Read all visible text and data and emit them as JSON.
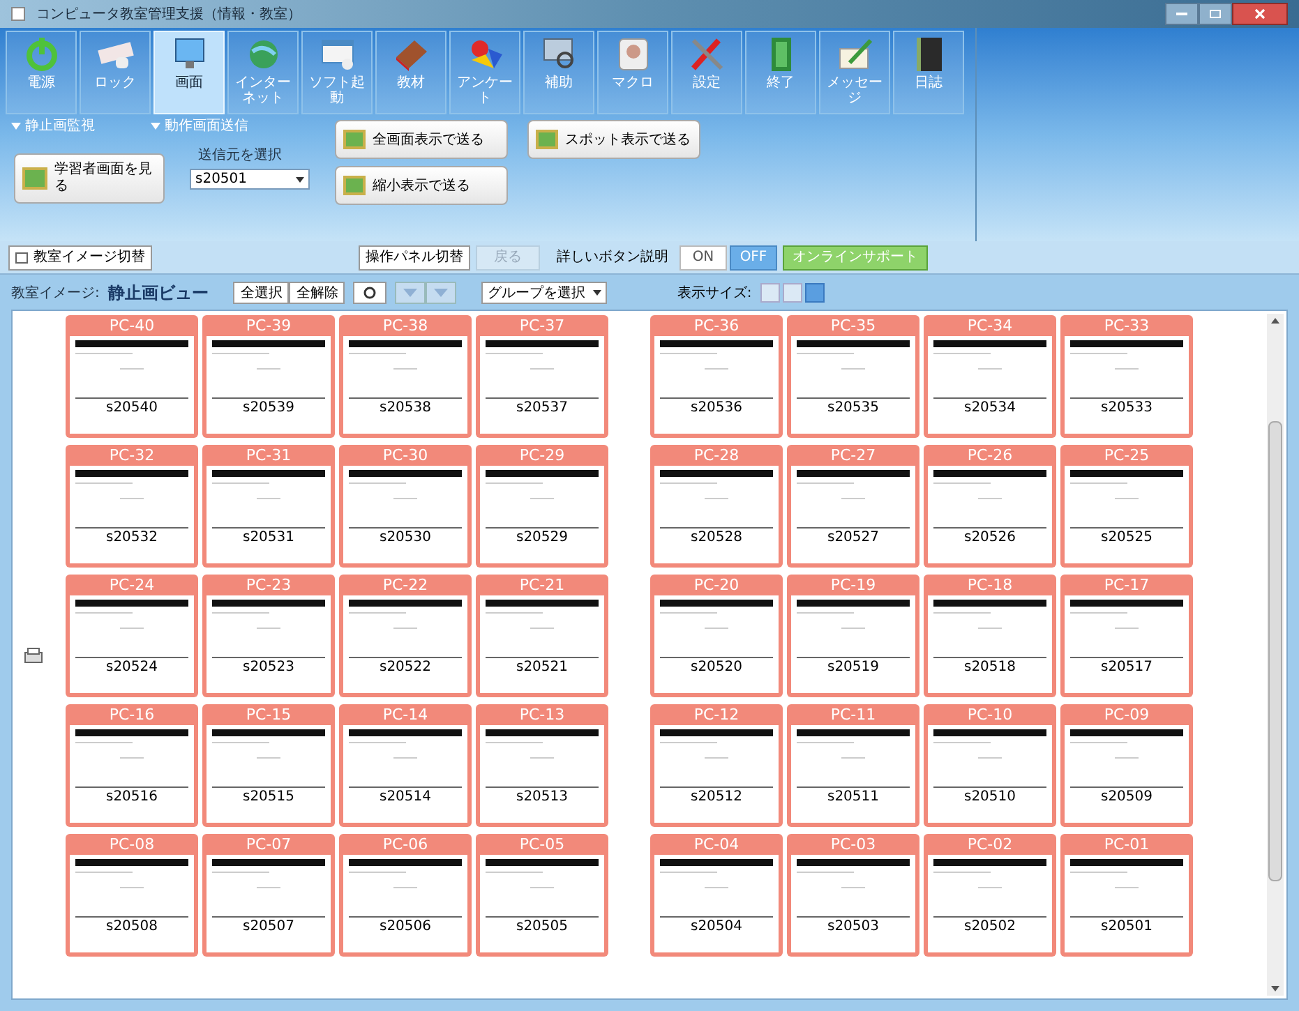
{
  "window": {
    "title": "コンピュータ教室管理支援（情報・教室）"
  },
  "toolbar": [
    {
      "label": "電源",
      "kind": "power",
      "selected": false
    },
    {
      "label": "ロック",
      "kind": "keyboard",
      "selected": false
    },
    {
      "label": "画面",
      "kind": "monitor",
      "selected": true
    },
    {
      "label": "インターネット",
      "kind": "globe",
      "selected": false
    },
    {
      "label": "ソフト起動",
      "kind": "window",
      "selected": false
    },
    {
      "label": "教材",
      "kind": "book",
      "selected": false
    },
    {
      "label": "アンケート",
      "kind": "shapes",
      "selected": false
    },
    {
      "label": "補助",
      "kind": "search",
      "selected": false
    },
    {
      "label": "マクロ",
      "kind": "disk",
      "selected": false
    },
    {
      "label": "設定",
      "kind": "tools",
      "selected": false
    },
    {
      "label": "終了",
      "kind": "door",
      "selected": false
    },
    {
      "label": "メッセージ",
      "kind": "pen",
      "selected": false
    },
    {
      "label": "日誌",
      "kind": "notebook",
      "selected": false
    }
  ],
  "ribbon": {
    "section_1": "静止画監視",
    "section_2": "動作画面送信",
    "view_button": "学習者画面を見る",
    "source_label": "送信元を選択",
    "source_value": "s20501",
    "send_buttons": [
      "全画面表示で送る",
      "スポット表示で送る",
      "縮小表示で送る"
    ]
  },
  "bar": {
    "classroom_toggle": "教室イメージ切替",
    "panel_toggle": "操作パネル切替",
    "back": {
      "label": "戻る",
      "disabled": true
    },
    "help_label": "詳しいボタン説明",
    "help_options": [
      {
        "label": "ON",
        "selected": false
      },
      {
        "label": "OFF",
        "selected": true
      }
    ],
    "support": "オンラインサポート"
  },
  "view_bar": {
    "label": "教室イメージ:",
    "view_name": "静止画ビュー",
    "select_all": "全選択",
    "deselect_all": "全解除",
    "group_select": "グループを選択",
    "size_label": "表示サイズ:",
    "sizes": [
      {
        "selected": false
      },
      {
        "selected": false
      },
      {
        "selected": true
      }
    ]
  },
  "rows": [
    {
      "left": [
        [
          "PC-40",
          "s20540"
        ],
        [
          "PC-39",
          "s20539"
        ],
        [
          "PC-38",
          "s20538"
        ],
        [
          "PC-37",
          "s20537"
        ]
      ],
      "right": [
        [
          "PC-36",
          "s20536"
        ],
        [
          "PC-35",
          "s20535"
        ],
        [
          "PC-34",
          "s20534"
        ],
        [
          "PC-33",
          "s20533"
        ]
      ]
    },
    {
      "left": [
        [
          "PC-32",
          "s20532"
        ],
        [
          "PC-31",
          "s20531"
        ],
        [
          "PC-30",
          "s20530"
        ],
        [
          "PC-29",
          "s20529"
        ]
      ],
      "right": [
        [
          "PC-28",
          "s20528"
        ],
        [
          "PC-27",
          "s20527"
        ],
        [
          "PC-26",
          "s20526"
        ],
        [
          "PC-25",
          "s20525"
        ]
      ]
    },
    {
      "left": [
        [
          "PC-24",
          "s20524"
        ],
        [
          "PC-23",
          "s20523"
        ],
        [
          "PC-22",
          "s20522"
        ],
        [
          "PC-21",
          "s20521"
        ]
      ],
      "right": [
        [
          "PC-20",
          "s20520"
        ],
        [
          "PC-19",
          "s20519"
        ],
        [
          "PC-18",
          "s20518"
        ],
        [
          "PC-17",
          "s20517"
        ]
      ]
    },
    {
      "left": [
        [
          "PC-16",
          "s20516"
        ],
        [
          "PC-15",
          "s20515"
        ],
        [
          "PC-14",
          "s20514"
        ],
        [
          "PC-13",
          "s20513"
        ]
      ],
      "right": [
        [
          "PC-12",
          "s20512"
        ],
        [
          "PC-11",
          "s20511"
        ],
        [
          "PC-10",
          "s20510"
        ],
        [
          "PC-09",
          "s20509"
        ]
      ]
    },
    {
      "left": [
        [
          "PC-08",
          "s20508"
        ],
        [
          "PC-07",
          "s20507"
        ],
        [
          "PC-06",
          "s20506"
        ],
        [
          "PC-05",
          "s20505"
        ]
      ],
      "right": [
        [
          "PC-04",
          "s20504"
        ],
        [
          "PC-03",
          "s20503"
        ],
        [
          "PC-02",
          "s20502"
        ],
        [
          "PC-01",
          "s20501"
        ]
      ]
    }
  ]
}
